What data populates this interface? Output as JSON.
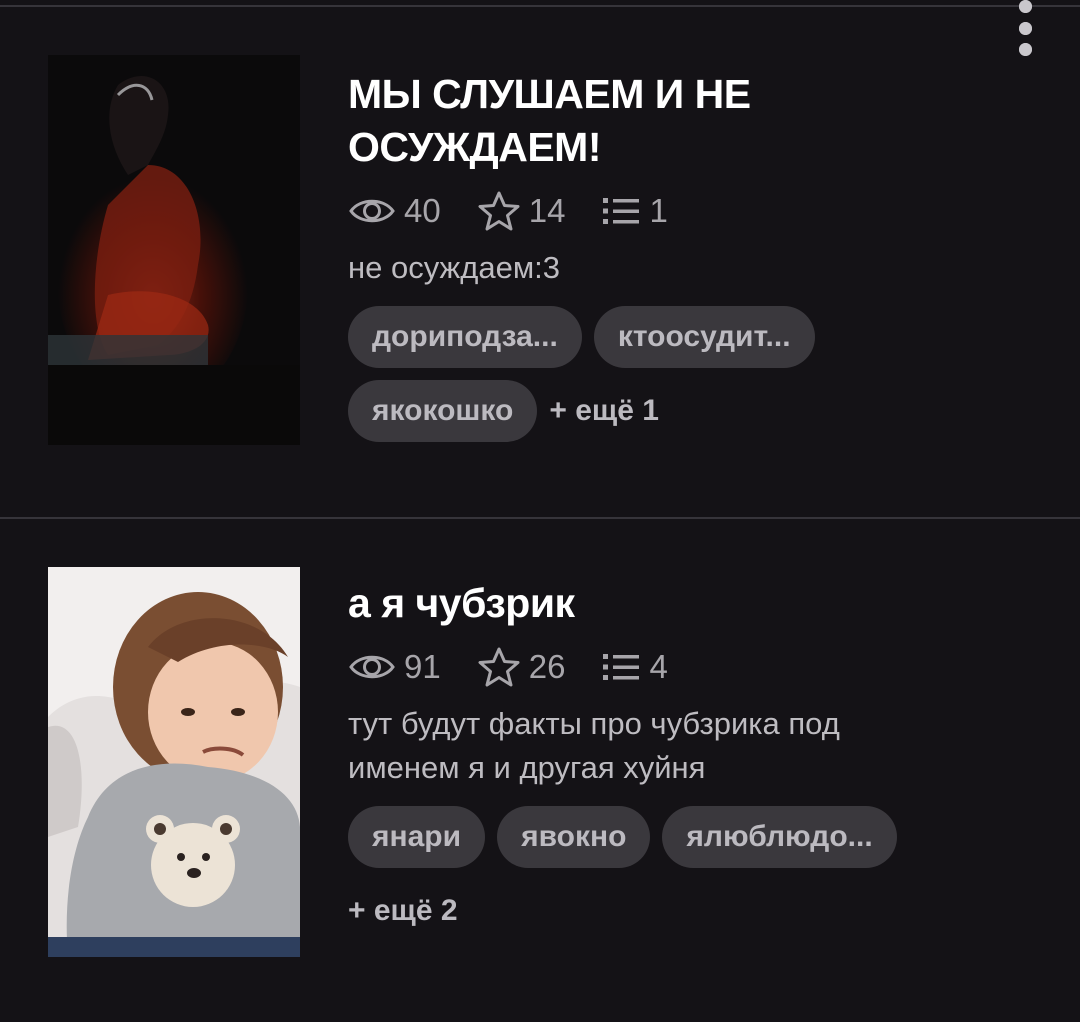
{
  "stories": [
    {
      "title": "МЫ СЛУШАЕМ И НЕ ОСУЖДАЕМ!",
      "views": "40",
      "stars": "14",
      "parts": "1",
      "description": "не осуждаем:3",
      "tags": [
        "дориподза...",
        "ктоосудит...",
        "якокошко"
      ],
      "more": "+ ещё 1",
      "cover_icon": "dark-figure-cover"
    },
    {
      "title": "а я чубзрик",
      "views": "91",
      "stars": "26",
      "parts": "4",
      "description": "тут будут факты про чубзрика под именем я и другая хуйня",
      "tags": [
        "янари",
        "явокно",
        "ялюблюдо..."
      ],
      "more": "+ ещё 2",
      "cover_icon": "child-photo-cover"
    }
  ],
  "icons": {
    "views": "eye-icon",
    "stars": "star-icon",
    "parts": "list-icon",
    "menu": "more-vertical-icon"
  },
  "colors": {
    "background": "#141216",
    "tag_background": "#3a383d",
    "stat_text": "#a7a5aa"
  }
}
